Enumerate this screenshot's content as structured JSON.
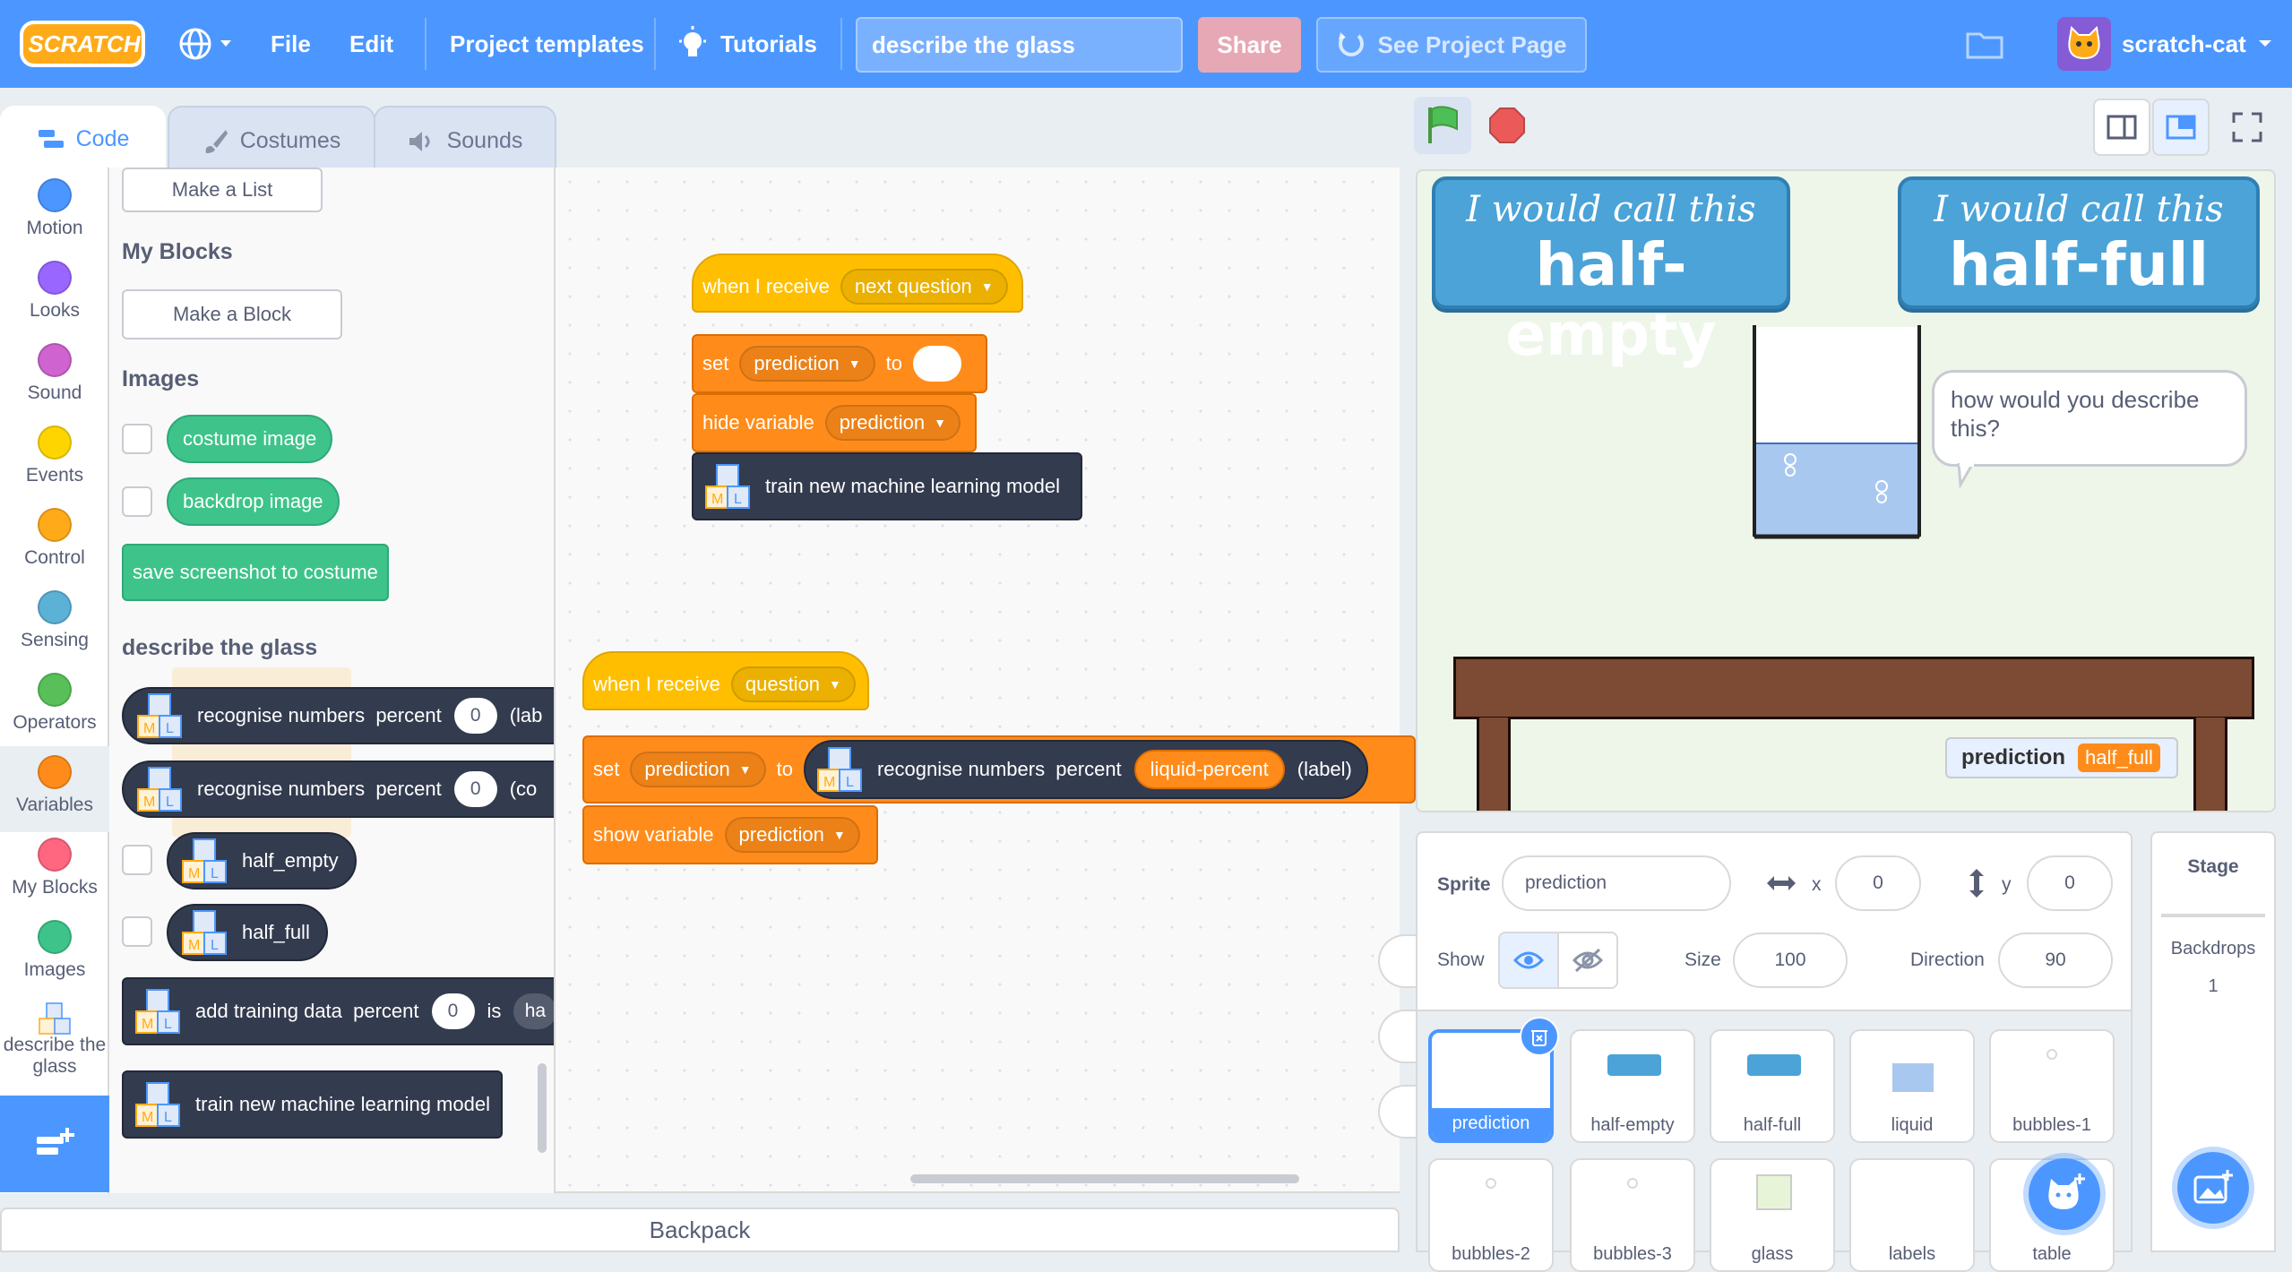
{
  "menu": {
    "logo": "SCRATCH",
    "file": "File",
    "edit": "Edit",
    "project_templates": "Project templates",
    "tutorials": "Tutorials",
    "project_title": "describe the glass",
    "share": "Share",
    "see_project_page": "See Project Page",
    "username": "scratch-cat"
  },
  "tabs": {
    "code": "Code",
    "costumes": "Costumes",
    "sounds": "Sounds"
  },
  "categories": [
    {
      "label": "Motion",
      "color": "#4c97ff"
    },
    {
      "label": "Looks",
      "color": "#9966ff"
    },
    {
      "label": "Sound",
      "color": "#cf63cf"
    },
    {
      "label": "Events",
      "color": "#ffd500"
    },
    {
      "label": "Control",
      "color": "#ffab19"
    },
    {
      "label": "Sensing",
      "color": "#5cb1d6"
    },
    {
      "label": "Operators",
      "color": "#59c059"
    },
    {
      "label": "Variables",
      "color": "#ff8c1a"
    },
    {
      "label": "My Blocks",
      "color": "#ff6680"
    },
    {
      "label": "Images",
      "color": "#3ec48a"
    },
    {
      "label": "describe the glass",
      "line1": "describe the",
      "line2": "glass"
    }
  ],
  "palette": {
    "make_list": "Make a List",
    "my_blocks_heading": "My Blocks",
    "make_block": "Make a Block",
    "images_heading": "Images",
    "costume_image": "costume image",
    "backdrop_image": "backdrop image",
    "save_screenshot": "save screenshot to costume",
    "ext_heading": "describe the glass",
    "recognise_label": "recognise numbers  percent",
    "recognise_1_default": "0",
    "recognise_1_tail": "(lab",
    "recognise_2_default": "0",
    "recognise_2_tail": "(co",
    "half_empty": "half_empty",
    "half_full": "half_full",
    "add_training": "add training data  percent",
    "add_training_default": "0",
    "add_training_is": "is",
    "add_training_tail": "ha",
    "train_model": "train new machine learning model"
  },
  "script1": {
    "hat": "when I receive",
    "hat_msg": "next question",
    "set": "set",
    "set_var": "prediction",
    "to": "to",
    "hide": "hide variable",
    "hide_var": "prediction",
    "train": "train new machine learning model"
  },
  "script2": {
    "hat": "when I receive",
    "hat_msg": "question",
    "set": "set",
    "set_var": "prediction",
    "to": "to",
    "recognise": "recognise numbers  percent",
    "recognise_arg": "liquid-percent",
    "recognise_tail": "(label)",
    "show": "show variable",
    "show_var": "prediction"
  },
  "stage": {
    "sign_left_l1": "I would call this",
    "sign_left_l2": "half-empty",
    "sign_right_l1": "I would call this",
    "sign_right_l2": "half-full",
    "speech": "how would you describe this?",
    "monitor_label": "prediction",
    "monitor_value": "half_full"
  },
  "sprite_info": {
    "sprite_label": "Sprite",
    "sprite_name": "prediction",
    "x_label": "x",
    "x": "0",
    "y_label": "y",
    "y": "0",
    "show_label": "Show",
    "size_label": "Size",
    "size": "100",
    "direction_label": "Direction",
    "direction": "90"
  },
  "sprites": [
    {
      "name": "prediction",
      "selected": true
    },
    {
      "name": "half-empty"
    },
    {
      "name": "half-full"
    },
    {
      "name": "liquid"
    },
    {
      "name": "bubbles-1"
    },
    {
      "name": "bubbles-2"
    },
    {
      "name": "bubbles-3"
    },
    {
      "name": "glass"
    },
    {
      "name": "labels"
    },
    {
      "name": "table"
    }
  ],
  "stage_panel": {
    "title": "Stage",
    "backdrops_label": "Backdrops",
    "backdrops_count": "1"
  },
  "backpack": "Backpack",
  "colors": {
    "accent": "#4c97ff",
    "events": "#ffbf00",
    "variables": "#ff8c1a",
    "ml": "#333b4f",
    "images": "#3ec48a"
  }
}
